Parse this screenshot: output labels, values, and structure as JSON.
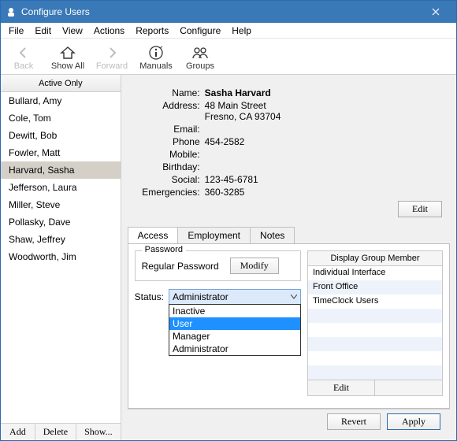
{
  "window": {
    "title": "Configure Users"
  },
  "menubar": [
    "File",
    "Edit",
    "View",
    "Actions",
    "Reports",
    "Configure",
    "Help"
  ],
  "toolbar": {
    "back": {
      "label": "Back",
      "enabled": false
    },
    "show": {
      "label": "Show All",
      "enabled": true
    },
    "fwd": {
      "label": "Forward",
      "enabled": false
    },
    "man": {
      "label": "Manuals",
      "enabled": true
    },
    "grp": {
      "label": "Groups",
      "enabled": true
    }
  },
  "sidebar": {
    "header": "Active Only",
    "users": [
      "Bullard, Amy",
      "Cole, Tom",
      "Dewitt, Bob",
      "Fowler, Matt",
      "Harvard, Sasha",
      "Jefferson, Laura",
      "Miller, Steve",
      "Pollasky, Dave",
      "Shaw, Jeffrey",
      "Woodworth, Jim"
    ],
    "selected_index": 4,
    "buttons": {
      "add": "Add",
      "delete": "Delete",
      "show": "Show..."
    }
  },
  "details": {
    "labels": {
      "name": "Name:",
      "address": "Address:",
      "email": "Email:",
      "phone": "Phone",
      "mobile": "Mobile:",
      "birthday": "Birthday:",
      "social": "Social:",
      "emerg": "Emergencies:"
    },
    "name": "Sasha Harvard",
    "address_line1": "48 Main Street",
    "address_line2": "Fresno, CA 93704",
    "email": "",
    "phone": "454-2582",
    "mobile": "",
    "birthday": "",
    "social": "123-45-6781",
    "emerg": "360-3285",
    "edit": "Edit"
  },
  "tabs": {
    "items": [
      "Access",
      "Employment",
      "Notes"
    ],
    "active_index": 0
  },
  "access": {
    "password_legend": "Password",
    "password_label": "Regular Password",
    "modify": "Modify",
    "status_label": "Status:",
    "status_selected": "Administrator",
    "status_options": [
      "Inactive",
      "User",
      "Manager",
      "Administrator"
    ],
    "status_highlight_index": 1,
    "groups_header": "Display Group Member",
    "groups": [
      "Individual Interface",
      "Front Office",
      "TimeClock Users",
      "",
      "",
      "",
      "",
      ""
    ],
    "groups_edit": "Edit"
  },
  "footer": {
    "revert": "Revert",
    "apply": "Apply"
  }
}
